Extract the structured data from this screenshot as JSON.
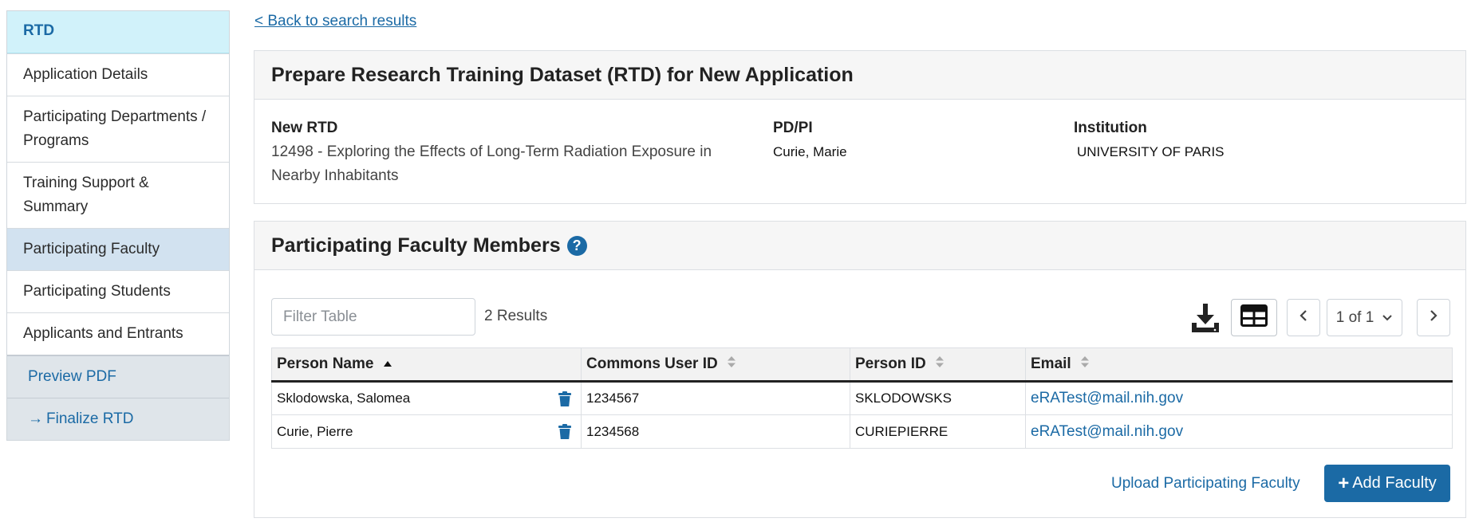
{
  "sidebar": {
    "header": "RTD",
    "items": [
      {
        "label": "Application Details"
      },
      {
        "label": "Participating Departments / Programs"
      },
      {
        "label": "Training Support & Summary"
      },
      {
        "label": "Participating Faculty"
      },
      {
        "label": "Participating Students"
      },
      {
        "label": "Applicants and Entrants"
      }
    ],
    "preview_label": "Preview PDF",
    "finalize_label": "Finalize RTD"
  },
  "back_link": "< Back to search results",
  "info": {
    "title": "Prepare Research Training Dataset (RTD) for New Application",
    "rtd_label": "New RTD",
    "rtd_value": "12498 - Exploring the Effects of Long-Term Radiation Exposure in Nearby Inhabitants",
    "pdpi_label": "PD/PI",
    "pdpi_value": "Curie, Marie",
    "institution_label": "Institution",
    "institution_value": "UNIVERSITY OF PARIS"
  },
  "faculty": {
    "title": "Participating Faculty Members",
    "help_glyph": "?",
    "filter_placeholder": "Filter Table",
    "results": "2 Results",
    "page": "1 of 1",
    "columns": [
      "Person Name",
      "Commons User ID",
      "Person ID",
      "Email"
    ],
    "rows": [
      {
        "name": "Sklodowska, Salomea",
        "commons_id": "1234567",
        "person_id": "SKLODOWSKS",
        "email": "eRATest@mail.nih.gov"
      },
      {
        "name": "Curie, Pierre",
        "commons_id": "1234568",
        "person_id": "CURIEPIERRE",
        "email": "eRATest@mail.nih.gov"
      }
    ],
    "upload_label": "Upload Participating Faculty",
    "add_label": "Add Faculty"
  },
  "colors": {
    "accent": "#1b6aa5",
    "sidebar_header_bg": "#d1f2fa",
    "sidebar_active_bg": "#d2e2f0"
  },
  "icons": [
    "help-icon",
    "download-icon",
    "table-view-icon",
    "chevron-left-icon",
    "chevron-down-icon",
    "chevron-right-icon",
    "sort-asc-icon",
    "sort-icon",
    "trash-icon",
    "arrow-right-icon",
    "plus-icon"
  ]
}
